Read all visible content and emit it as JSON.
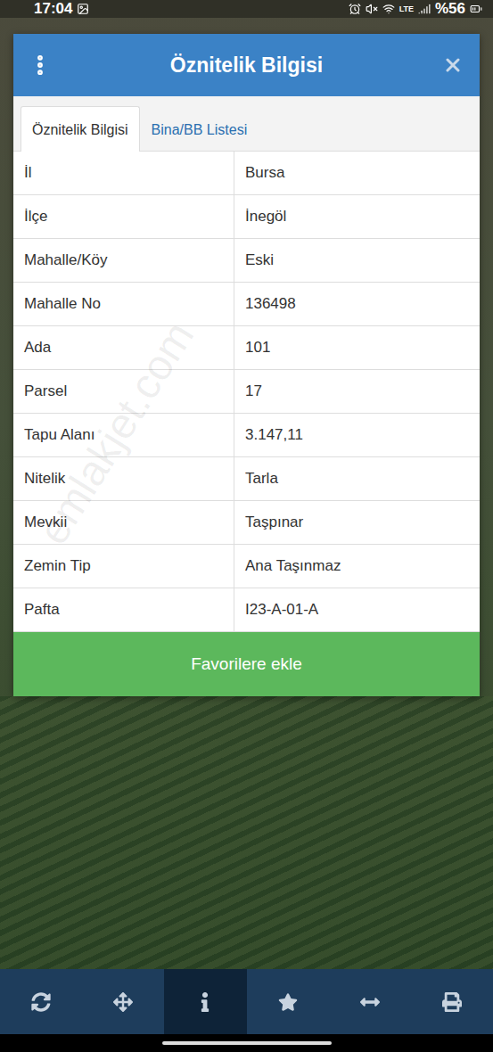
{
  "status_bar": {
    "time": "17:04",
    "network": "LTE",
    "battery": "%56"
  },
  "dialog": {
    "title": "Öznitelik Bilgisi"
  },
  "tabs": [
    {
      "label": "Öznitelik Bilgisi",
      "selected": true
    },
    {
      "label": "Bina/BB Listesi",
      "selected": false
    }
  ],
  "rows": [
    {
      "label": "İl",
      "value": "Bursa"
    },
    {
      "label": "İlçe",
      "value": "İnegöl"
    },
    {
      "label": "Mahalle/Köy",
      "value": "Eski"
    },
    {
      "label": "Mahalle No",
      "value": "136498"
    },
    {
      "label": "Ada",
      "value": "101"
    },
    {
      "label": "Parsel",
      "value": "17"
    },
    {
      "label": "Tapu Alanı",
      "value": "3.147,11"
    },
    {
      "label": "Nitelik",
      "value": "Tarla"
    },
    {
      "label": "Mevkii",
      "value": "Taşpınar"
    },
    {
      "label": "Zemin Tip",
      "value": "Ana Taşınmaz"
    },
    {
      "label": "Pafta",
      "value": "I23-A-01-A"
    }
  ],
  "button": "Favorilere ekle",
  "watermark": "emlakjet.com",
  "toolbar": [
    {
      "selected": false
    },
    {
      "selected": false
    },
    {
      "selected": true
    },
    {
      "selected": false
    },
    {
      "selected": false
    },
    {
      "selected": false
    }
  ]
}
